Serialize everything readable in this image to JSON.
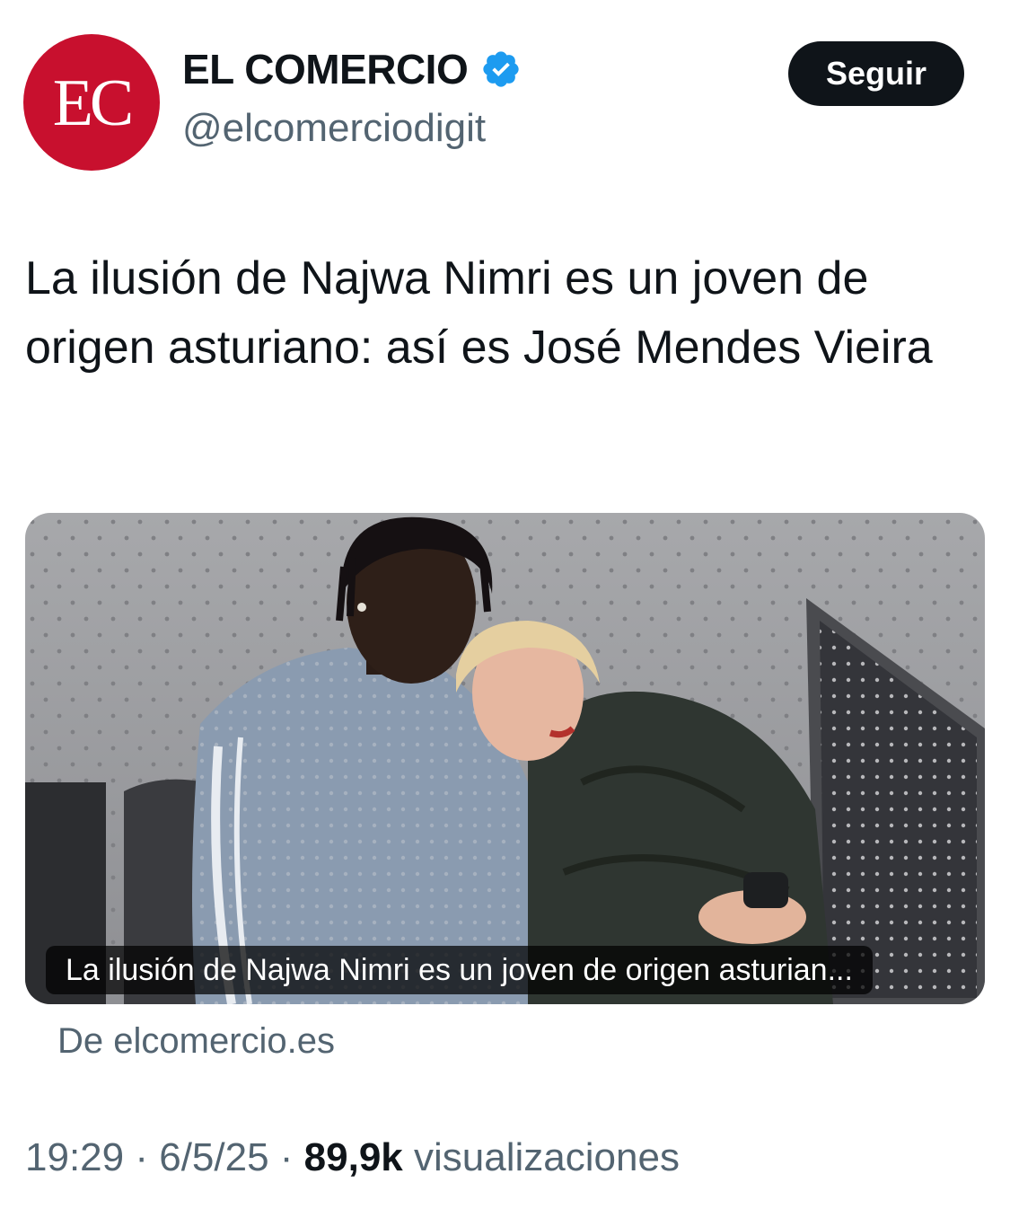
{
  "author": {
    "avatar_text": "EC",
    "name": "EL COMERCIO",
    "handle": "@elcomerciodigit",
    "verified_icon": "verified-badge-icon",
    "brand_color": "#c8102e",
    "verified_color": "#1d9bf0"
  },
  "follow_label": "Seguir",
  "tweet_text": "La ilusión de Najwa Nimri es un joven de origen asturiano: así es José Mendes Vieira",
  "card": {
    "caption": "La ilusión de Najwa Nimri es un joven de origen asturian...",
    "source": "De elcomercio.es"
  },
  "meta": {
    "time": "19:29",
    "date": "6/5/25",
    "views_count": "89,9k",
    "views_label": "visualizaciones",
    "separator": " · "
  }
}
